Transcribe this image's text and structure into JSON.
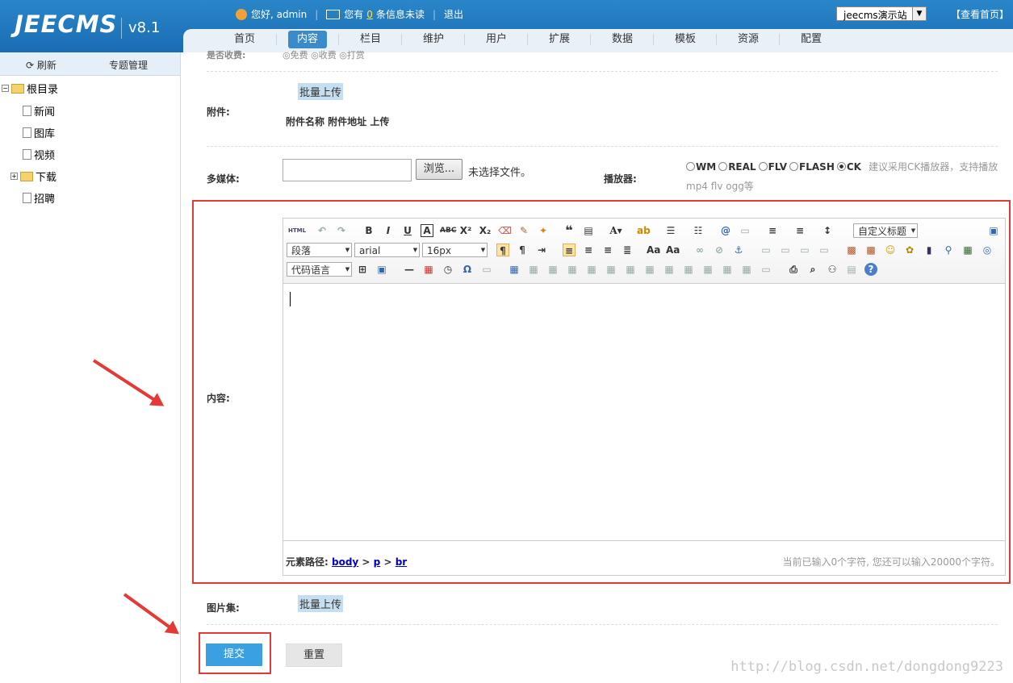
{
  "header": {
    "logo": "JEECMS",
    "version": "v8.1",
    "greeting": "您好, admin",
    "msg_prefix": "您有",
    "msg_count": "0",
    "msg_suffix": "条信息未读",
    "logout": "退出",
    "site": "jeecms演示站",
    "view_home": "【查看首页】"
  },
  "nav": [
    "首页",
    "内容",
    "栏目",
    "维护",
    "用户",
    "扩展",
    "数据",
    "模板",
    "资源",
    "配置"
  ],
  "nav_active": "内容",
  "sidebar": {
    "refresh": "刷新",
    "topic_mgr": "专题管理",
    "root": "根目录",
    "items": [
      "新闻",
      "图库",
      "视频",
      "下载",
      "招聘"
    ]
  },
  "form": {
    "top_partial": "是否收费:",
    "top_radios": "◎免费 ◎收费 ◎打赏",
    "attach_label": "附件:",
    "batch_upload": "批量上传",
    "attach_cols": "附件名称 附件地址 上传",
    "media_label": "多媒体:",
    "browse": "浏览...",
    "no_file": "未选择文件。",
    "player_label": "播放器:",
    "players": [
      "WM",
      "REAL",
      "FLV",
      "FLASH",
      "CK"
    ],
    "player_selected": "CK",
    "player_hint": "建议采用CK播放器，支持播放",
    "player_hint2": "mp4 flv ogg等",
    "content_label": "内容:",
    "gallery_label": "图片集:",
    "gallery_upload": "批量上传",
    "submit": "提交",
    "reset": "重置"
  },
  "editor": {
    "custom_heading": "自定义标题",
    "paragraph": "段落",
    "font": "arial",
    "size": "16px",
    "code_lang": "代码语言",
    "html_btn": "HTML",
    "path_label": "元素路径:",
    "path": [
      "body",
      "p",
      "br"
    ],
    "count_text": "当前已输入0个字符, 您还可以输入20000个字符。"
  },
  "watermark": "http://blog.csdn.net/dongdong9223"
}
